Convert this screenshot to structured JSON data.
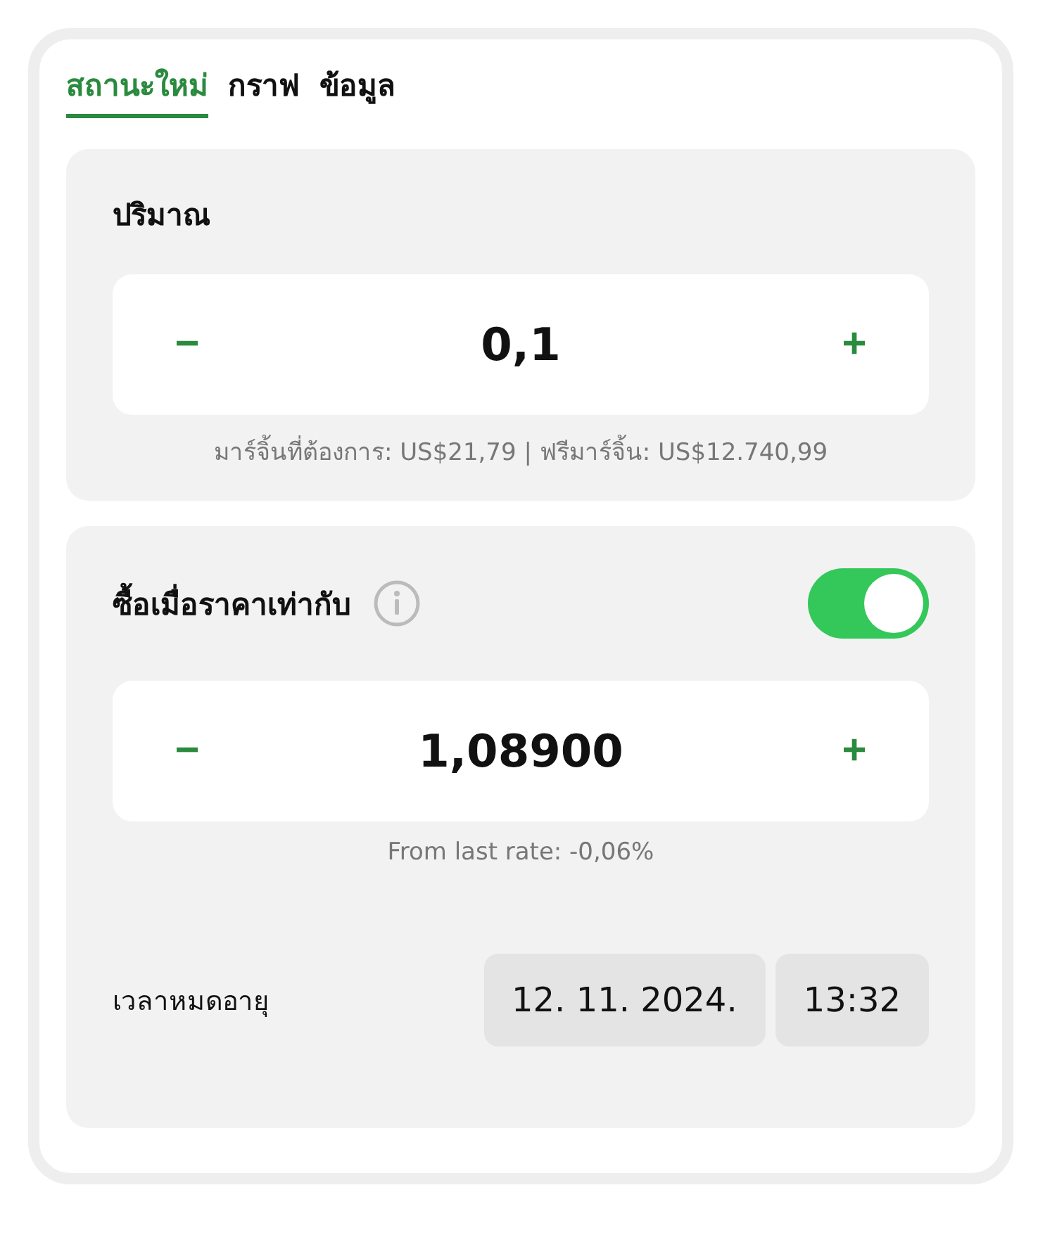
{
  "tabs": [
    {
      "label": "สถานะใหม่",
      "selected": true
    },
    {
      "label": "กราฟ",
      "selected": false
    },
    {
      "label": "ข้อมูล",
      "selected": false
    }
  ],
  "quantity": {
    "title": "ปริมาณ",
    "minus": "−",
    "value": "0,1",
    "plus": "+",
    "note": "มาร์จิ้นที่ต้องการ: US$21,79 | ฟรีมาร์จิ้น: US$12.740,99"
  },
  "price": {
    "title": "ซื้อเมื่อราคาเท่ากับ",
    "on": true,
    "minus": "−",
    "value": "1,08900",
    "plus": "+",
    "note": "From last rate: -0,06%",
    "expiry_label": "เวลาหมดอายุ",
    "date": "12. 11. 2024.",
    "time": "13:32"
  }
}
